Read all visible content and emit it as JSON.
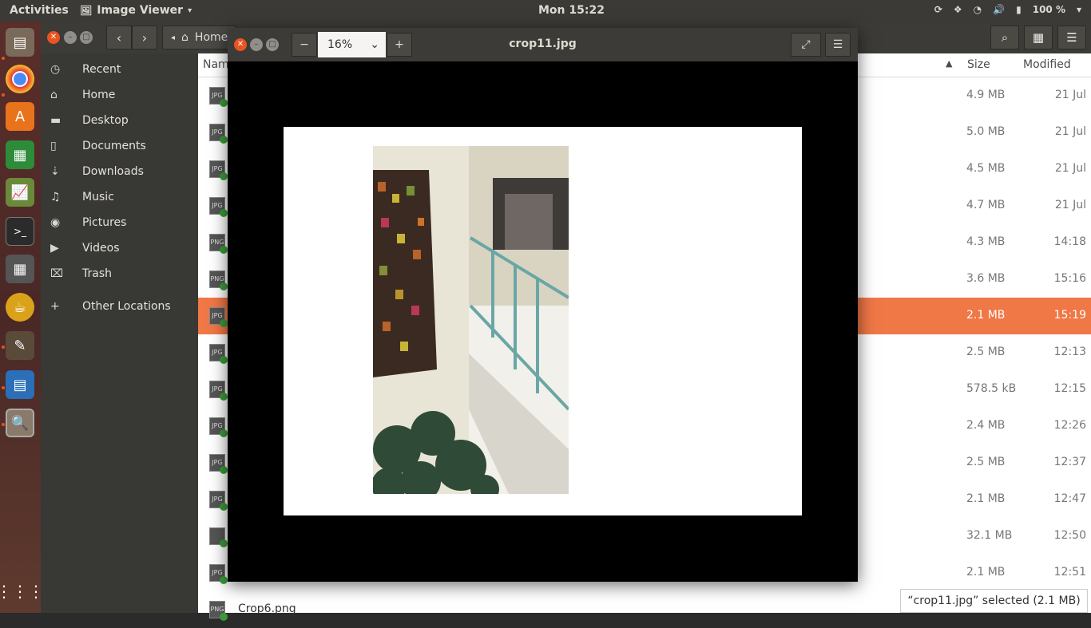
{
  "topbar": {
    "activities": "Activities",
    "app_name": "Image Viewer",
    "clock": "Mon 15:22",
    "battery": "100 %"
  },
  "dock": {
    "apps": [
      "files-icon",
      "chrome-icon",
      "software-center-icon",
      "spreadsheet-icon",
      "system-monitor-icon",
      "terminal-icon",
      "calculator-icon",
      "teapot-icon",
      "gimp-icon",
      "writer-icon",
      "image-viewer-icon"
    ]
  },
  "files": {
    "breadcrumb": "Home",
    "sidebar": [
      {
        "label": "Recent",
        "icon": "clock-icon"
      },
      {
        "label": "Home",
        "icon": "home-icon"
      },
      {
        "label": "Desktop",
        "icon": "folder-icon"
      },
      {
        "label": "Documents",
        "icon": "document-icon"
      },
      {
        "label": "Downloads",
        "icon": "download-icon"
      },
      {
        "label": "Music",
        "icon": "music-icon"
      },
      {
        "label": "Pictures",
        "icon": "camera-icon"
      },
      {
        "label": "Videos",
        "icon": "video-icon"
      },
      {
        "label": "Trash",
        "icon": "trash-icon"
      },
      {
        "label": "Other Locations",
        "icon": "plus-icon"
      }
    ],
    "columns": {
      "name": "Nam",
      "size": "Size",
      "modified": "Modified"
    },
    "rows": [
      {
        "type": "JPG",
        "size": "4.9 MB",
        "modified": "21 Jul"
      },
      {
        "type": "JPG",
        "size": "5.0 MB",
        "modified": "21 Jul"
      },
      {
        "type": "JPG",
        "size": "4.5 MB",
        "modified": "21 Jul"
      },
      {
        "type": "JPG",
        "size": "4.7 MB",
        "modified": "21 Jul"
      },
      {
        "type": "PNG",
        "size": "4.3 MB",
        "modified": "14:18"
      },
      {
        "type": "PNG",
        "size": "3.6 MB",
        "modified": "15:16"
      },
      {
        "type": "JPG",
        "size": "2.1 MB",
        "modified": "15:19",
        "selected": true
      },
      {
        "type": "JPG",
        "size": "2.5 MB",
        "modified": "12:13"
      },
      {
        "type": "JPG",
        "size": "578.5 kB",
        "modified": "12:15"
      },
      {
        "type": "JPG",
        "size": "2.4 MB",
        "modified": "12:26"
      },
      {
        "type": "JPG",
        "size": "2.5 MB",
        "modified": "12:37"
      },
      {
        "type": "JPG",
        "size": "2.1 MB",
        "modified": "12:47"
      },
      {
        "type": "",
        "size": "32.1 MB",
        "modified": "12:50"
      },
      {
        "type": "JPG",
        "size": "2.1 MB",
        "modified": "12:51"
      },
      {
        "type": "PNG",
        "size": "",
        "modified": "",
        "name": "Crop6.png"
      }
    ],
    "status": "“crop11.jpg” selected  (2.1 MB)"
  },
  "viewer": {
    "title": "crop11.jpg",
    "zoom": "16%"
  }
}
